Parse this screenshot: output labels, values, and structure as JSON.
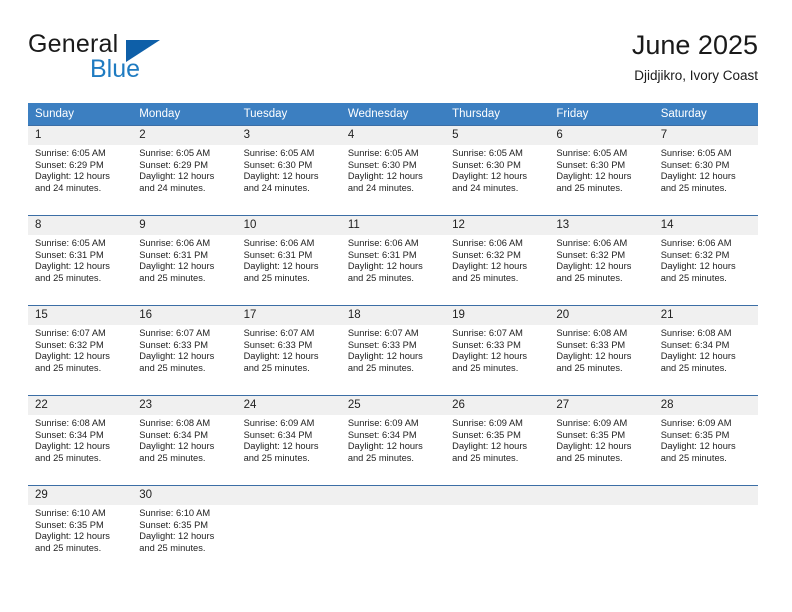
{
  "brand": {
    "name_part1": "General",
    "name_part2": "Blue",
    "logo_icon": "blue-triangle-logo"
  },
  "header": {
    "title": "June 2025",
    "location": "Djidjikro, Ivory Coast"
  },
  "colors": {
    "header_row_bg": "#3c7fc1",
    "day_number_bg": "#f0f0f0",
    "row_divider": "#3c6ea5",
    "brand_blue": "#1f7bc1",
    "logo_blue": "#0e5fa8"
  },
  "calendar": {
    "weekday_headers": [
      "Sunday",
      "Monday",
      "Tuesday",
      "Wednesday",
      "Thursday",
      "Friday",
      "Saturday"
    ],
    "weeks": [
      [
        {
          "day": "1",
          "sunrise": "Sunrise: 6:05 AM",
          "sunset": "Sunset: 6:29 PM",
          "daylight_line1": "Daylight: 12 hours",
          "daylight_line2": "and 24 minutes."
        },
        {
          "day": "2",
          "sunrise": "Sunrise: 6:05 AM",
          "sunset": "Sunset: 6:29 PM",
          "daylight_line1": "Daylight: 12 hours",
          "daylight_line2": "and 24 minutes."
        },
        {
          "day": "3",
          "sunrise": "Sunrise: 6:05 AM",
          "sunset": "Sunset: 6:30 PM",
          "daylight_line1": "Daylight: 12 hours",
          "daylight_line2": "and 24 minutes."
        },
        {
          "day": "4",
          "sunrise": "Sunrise: 6:05 AM",
          "sunset": "Sunset: 6:30 PM",
          "daylight_line1": "Daylight: 12 hours",
          "daylight_line2": "and 24 minutes."
        },
        {
          "day": "5",
          "sunrise": "Sunrise: 6:05 AM",
          "sunset": "Sunset: 6:30 PM",
          "daylight_line1": "Daylight: 12 hours",
          "daylight_line2": "and 24 minutes."
        },
        {
          "day": "6",
          "sunrise": "Sunrise: 6:05 AM",
          "sunset": "Sunset: 6:30 PM",
          "daylight_line1": "Daylight: 12 hours",
          "daylight_line2": "and 25 minutes."
        },
        {
          "day": "7",
          "sunrise": "Sunrise: 6:05 AM",
          "sunset": "Sunset: 6:30 PM",
          "daylight_line1": "Daylight: 12 hours",
          "daylight_line2": "and 25 minutes."
        }
      ],
      [
        {
          "day": "8",
          "sunrise": "Sunrise: 6:05 AM",
          "sunset": "Sunset: 6:31 PM",
          "daylight_line1": "Daylight: 12 hours",
          "daylight_line2": "and 25 minutes."
        },
        {
          "day": "9",
          "sunrise": "Sunrise: 6:06 AM",
          "sunset": "Sunset: 6:31 PM",
          "daylight_line1": "Daylight: 12 hours",
          "daylight_line2": "and 25 minutes."
        },
        {
          "day": "10",
          "sunrise": "Sunrise: 6:06 AM",
          "sunset": "Sunset: 6:31 PM",
          "daylight_line1": "Daylight: 12 hours",
          "daylight_line2": "and 25 minutes."
        },
        {
          "day": "11",
          "sunrise": "Sunrise: 6:06 AM",
          "sunset": "Sunset: 6:31 PM",
          "daylight_line1": "Daylight: 12 hours",
          "daylight_line2": "and 25 minutes."
        },
        {
          "day": "12",
          "sunrise": "Sunrise: 6:06 AM",
          "sunset": "Sunset: 6:32 PM",
          "daylight_line1": "Daylight: 12 hours",
          "daylight_line2": "and 25 minutes."
        },
        {
          "day": "13",
          "sunrise": "Sunrise: 6:06 AM",
          "sunset": "Sunset: 6:32 PM",
          "daylight_line1": "Daylight: 12 hours",
          "daylight_line2": "and 25 minutes."
        },
        {
          "day": "14",
          "sunrise": "Sunrise: 6:06 AM",
          "sunset": "Sunset: 6:32 PM",
          "daylight_line1": "Daylight: 12 hours",
          "daylight_line2": "and 25 minutes."
        }
      ],
      [
        {
          "day": "15",
          "sunrise": "Sunrise: 6:07 AM",
          "sunset": "Sunset: 6:32 PM",
          "daylight_line1": "Daylight: 12 hours",
          "daylight_line2": "and 25 minutes."
        },
        {
          "day": "16",
          "sunrise": "Sunrise: 6:07 AM",
          "sunset": "Sunset: 6:33 PM",
          "daylight_line1": "Daylight: 12 hours",
          "daylight_line2": "and 25 minutes."
        },
        {
          "day": "17",
          "sunrise": "Sunrise: 6:07 AM",
          "sunset": "Sunset: 6:33 PM",
          "daylight_line1": "Daylight: 12 hours",
          "daylight_line2": "and 25 minutes."
        },
        {
          "day": "18",
          "sunrise": "Sunrise: 6:07 AM",
          "sunset": "Sunset: 6:33 PM",
          "daylight_line1": "Daylight: 12 hours",
          "daylight_line2": "and 25 minutes."
        },
        {
          "day": "19",
          "sunrise": "Sunrise: 6:07 AM",
          "sunset": "Sunset: 6:33 PM",
          "daylight_line1": "Daylight: 12 hours",
          "daylight_line2": "and 25 minutes."
        },
        {
          "day": "20",
          "sunrise": "Sunrise: 6:08 AM",
          "sunset": "Sunset: 6:33 PM",
          "daylight_line1": "Daylight: 12 hours",
          "daylight_line2": "and 25 minutes."
        },
        {
          "day": "21",
          "sunrise": "Sunrise: 6:08 AM",
          "sunset": "Sunset: 6:34 PM",
          "daylight_line1": "Daylight: 12 hours",
          "daylight_line2": "and 25 minutes."
        }
      ],
      [
        {
          "day": "22",
          "sunrise": "Sunrise: 6:08 AM",
          "sunset": "Sunset: 6:34 PM",
          "daylight_line1": "Daylight: 12 hours",
          "daylight_line2": "and 25 minutes."
        },
        {
          "day": "23",
          "sunrise": "Sunrise: 6:08 AM",
          "sunset": "Sunset: 6:34 PM",
          "daylight_line1": "Daylight: 12 hours",
          "daylight_line2": "and 25 minutes."
        },
        {
          "day": "24",
          "sunrise": "Sunrise: 6:09 AM",
          "sunset": "Sunset: 6:34 PM",
          "daylight_line1": "Daylight: 12 hours",
          "daylight_line2": "and 25 minutes."
        },
        {
          "day": "25",
          "sunrise": "Sunrise: 6:09 AM",
          "sunset": "Sunset: 6:34 PM",
          "daylight_line1": "Daylight: 12 hours",
          "daylight_line2": "and 25 minutes."
        },
        {
          "day": "26",
          "sunrise": "Sunrise: 6:09 AM",
          "sunset": "Sunset: 6:35 PM",
          "daylight_line1": "Daylight: 12 hours",
          "daylight_line2": "and 25 minutes."
        },
        {
          "day": "27",
          "sunrise": "Sunrise: 6:09 AM",
          "sunset": "Sunset: 6:35 PM",
          "daylight_line1": "Daylight: 12 hours",
          "daylight_line2": "and 25 minutes."
        },
        {
          "day": "28",
          "sunrise": "Sunrise: 6:09 AM",
          "sunset": "Sunset: 6:35 PM",
          "daylight_line1": "Daylight: 12 hours",
          "daylight_line2": "and 25 minutes."
        }
      ],
      [
        {
          "day": "29",
          "sunrise": "Sunrise: 6:10 AM",
          "sunset": "Sunset: 6:35 PM",
          "daylight_line1": "Daylight: 12 hours",
          "daylight_line2": "and 25 minutes."
        },
        {
          "day": "30",
          "sunrise": "Sunrise: 6:10 AM",
          "sunset": "Sunset: 6:35 PM",
          "daylight_line1": "Daylight: 12 hours",
          "daylight_line2": "and 25 minutes."
        },
        {
          "day": "",
          "sunrise": "",
          "sunset": "",
          "daylight_line1": "",
          "daylight_line2": ""
        },
        {
          "day": "",
          "sunrise": "",
          "sunset": "",
          "daylight_line1": "",
          "daylight_line2": ""
        },
        {
          "day": "",
          "sunrise": "",
          "sunset": "",
          "daylight_line1": "",
          "daylight_line2": ""
        },
        {
          "day": "",
          "sunrise": "",
          "sunset": "",
          "daylight_line1": "",
          "daylight_line2": ""
        },
        {
          "day": "",
          "sunrise": "",
          "sunset": "",
          "daylight_line1": "",
          "daylight_line2": ""
        }
      ]
    ]
  }
}
